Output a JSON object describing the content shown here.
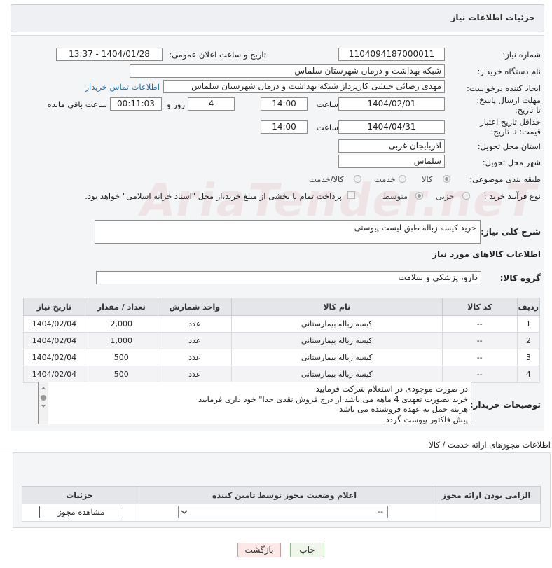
{
  "header": {
    "title": "جزئیات اطلاعات نیاز"
  },
  "form": {
    "need_number": {
      "label": "شماره نیاز:",
      "value": "1104094187000011"
    },
    "announce_datetime": {
      "label": "تاریخ و ساعت اعلان عمومی:",
      "value": "1404/01/28 - 13:37"
    },
    "buyer_org": {
      "label": "نام دستگاه خریدار:",
      "value": "شبکه بهداشت و درمان  شهرستان سلماس"
    },
    "requester": {
      "label": "ایجاد کننده درخواست:",
      "value": "مهدی رضائی حبشی کارپرداز شبکه بهداشت و درمان  شهرستان سلماس",
      "contact_link": "اطلاعات تماس خریدار"
    },
    "send_deadline": {
      "label": "مهلت ارسال پاسخ: تا تاریخ:",
      "date": "1404/02/01",
      "time_label": "ساعت",
      "time": "14:00",
      "days": "4",
      "days_label": "روز و",
      "remaining": "00:11:03",
      "remaining_label": "ساعت باقی مانده"
    },
    "price_validity": {
      "label": "حداقل تاریخ اعتبار قیمت: تا تاریخ:",
      "date": "1404/04/31",
      "time_label": "ساعت",
      "time": "14:00"
    },
    "province": {
      "label": "استان محل تحویل:",
      "value": "آذربایجان غربی"
    },
    "city": {
      "label": "شهر محل تحویل:",
      "value": "سلماس"
    },
    "category": {
      "label": "طبقه بندی موضوعی:",
      "options": [
        "کالا",
        "خدمت",
        "کالا/خدمت"
      ],
      "selected": "کالا"
    },
    "purchase_type": {
      "label": "نوع فرآیند خرید :",
      "options": [
        "جزیی",
        "متوسط"
      ],
      "selected": "متوسط",
      "note": "پرداخت تمام یا بخشی از مبلغ خرید،از محل \"اسناد خزانه اسلامی\" خواهد بود."
    },
    "description": {
      "label": "شرح کلی نیاز:",
      "value": "خرید کیسه زباله طبق لیست پیوستی"
    }
  },
  "goods": {
    "section_title": "اطلاعات کالاهای مورد نیاز",
    "group_label": "گروه کالا:",
    "group_value": "دارو، پزشکی و سلامت",
    "columns": [
      "ردیف",
      "کد کالا",
      "نام کالا",
      "واحد شمارش",
      "تعداد / مقدار",
      "تاریخ نیاز"
    ],
    "rows": [
      [
        "1",
        "--",
        "کیسه زباله بیمارستانی",
        "عدد",
        "2,000",
        "1404/02/04"
      ],
      [
        "2",
        "--",
        "کیسه زباله بیمارستانی",
        "عدد",
        "1,000",
        "1404/02/04"
      ],
      [
        "3",
        "--",
        "کیسه زباله بیمارستانی",
        "عدد",
        "500",
        "1404/02/04"
      ],
      [
        "4",
        "--",
        "کیسه زباله بیمارستانی",
        "عدد",
        "500",
        "1404/02/04"
      ]
    ]
  },
  "buyer_notes": {
    "label": "توضیحات خریدار:",
    "lines": [
      "در صورت موجودی در استعلام شرکت فرمایید",
      "خرید بصورت تعهدی 4 ماهه می باشد از درج فروش نقدی جدا\" خود داری فرمایید",
      "هزینه حمل به عهده فروشنده می باشد",
      "پیش فاکتور پیوست گردد"
    ]
  },
  "permits": {
    "section_title": "اطلاعات مجوزهای ارائه خدمت / کالا",
    "columns": [
      "الزامی بودن ارائه مجوز",
      "اعلام وضعیت مجوز توسط تامین کننده",
      "جزئیات"
    ],
    "select_value": "--",
    "view_button": "مشاهده مجوز"
  },
  "actions": {
    "print": "چاپ",
    "back": "بازگشت"
  },
  "watermark": "AriaTender.neT"
}
